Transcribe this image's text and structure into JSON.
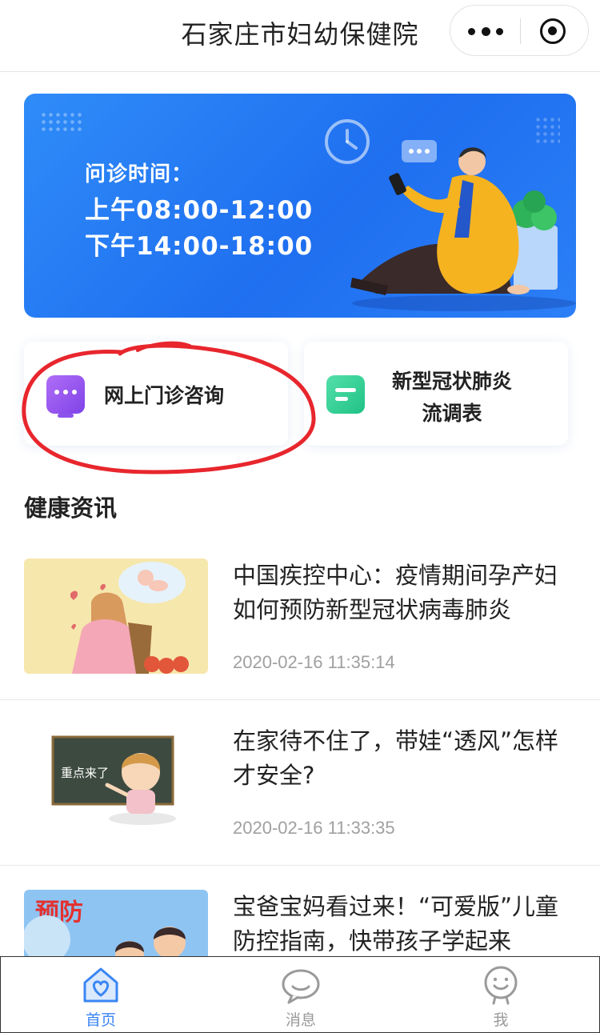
{
  "header": {
    "title": "石家庄市妇幼保健院"
  },
  "banner": {
    "line1": "问诊时间：",
    "line2": "上午08:00-12:00",
    "line3": "下午14:00-18:00"
  },
  "quick_actions": [
    {
      "label": "网上门诊咨询"
    },
    {
      "label": "新型冠状肺炎流调表"
    }
  ],
  "section": {
    "title": "健康资讯"
  },
  "news": [
    {
      "title": "中国疾控中心：疫情期间孕产妇如何预防新型冠状病毒肺炎",
      "time": "2020-02-16 11:35:14"
    },
    {
      "title": "在家待不住了，带娃“透风”怎样才安全?",
      "time": "2020-02-16 11:33:35",
      "thumb_text": "重点来了"
    },
    {
      "title": "宝爸宝妈看过来！“可爱版”儿童防控指南，快带孩子学起来",
      "thumb_text": "预防"
    }
  ],
  "tabbar": {
    "items": [
      {
        "label": "首页",
        "icon": "home-heart-icon",
        "active": true
      },
      {
        "label": "消息",
        "icon": "chat-bubble-icon",
        "active": false
      },
      {
        "label": "我",
        "icon": "user-face-icon",
        "active": false
      }
    ],
    "active_color": "#3a86f3",
    "inactive_color": "#9a9a9a"
  },
  "colors": {
    "banner_blue": "#1f6ff0",
    "annotation_red": "#e8262d"
  }
}
